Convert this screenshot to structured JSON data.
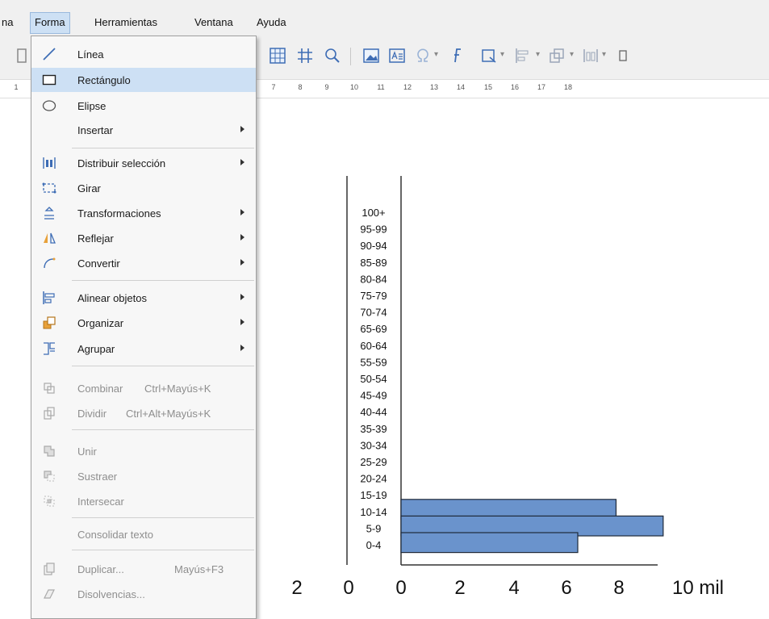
{
  "menubar": {
    "items": [
      {
        "label": "na"
      },
      {
        "label": "Forma",
        "open": true
      },
      {
        "label": "Herramientas"
      },
      {
        "label": "Ventana"
      },
      {
        "label": "Ayuda"
      }
    ]
  },
  "toolbar": {
    "icons": [
      "page-icon",
      "grid-icon",
      "hash-icon",
      "zoom-icon",
      "image-icon",
      "textbox-icon",
      "special-character-icon",
      "fontwork-icon",
      "transform-icon",
      "align-icon",
      "arrange-icon",
      "distribute-icon",
      "more-icon"
    ]
  },
  "ruler": {
    "numbers": [
      "1",
      "7",
      "8",
      "9",
      "10",
      "11",
      "12",
      "13",
      "14",
      "15",
      "16",
      "17",
      "18"
    ]
  },
  "menu": {
    "items": [
      {
        "label": "Línea",
        "icon": "line-icon",
        "enabled": true,
        "submenu": false
      },
      {
        "label": "Rectángulo",
        "icon": "rectangle-icon",
        "enabled": true,
        "submenu": false,
        "selected": true
      },
      {
        "label": "Elipse",
        "icon": "ellipse-icon",
        "enabled": true,
        "submenu": false
      },
      {
        "label": "Insertar",
        "icon": "",
        "enabled": true,
        "submenu": true
      },
      {
        "label": "Distribuir selección",
        "icon": "distribute-icon",
        "enabled": true,
        "submenu": true
      },
      {
        "label": "Girar",
        "icon": "rotate-icon",
        "enabled": true,
        "submenu": false
      },
      {
        "label": "Transformaciones",
        "icon": "transform-icon",
        "enabled": true,
        "submenu": true
      },
      {
        "label": "Reflejar",
        "icon": "flip-icon",
        "enabled": true,
        "submenu": true
      },
      {
        "label": "Convertir",
        "icon": "convert-icon",
        "enabled": true,
        "submenu": true
      },
      {
        "label": "Alinear objetos",
        "icon": "align-icon",
        "enabled": true,
        "submenu": true
      },
      {
        "label": "Organizar",
        "icon": "arrange-icon",
        "enabled": true,
        "submenu": true
      },
      {
        "label": "Agrupar",
        "icon": "group-icon",
        "enabled": true,
        "submenu": true
      },
      {
        "label": "Combinar",
        "shortcut": "Ctrl+Mayús+K",
        "icon": "combine-icon",
        "enabled": false,
        "submenu": false
      },
      {
        "label": "Dividir",
        "shortcut": "Ctrl+Alt+Mayús+K",
        "icon": "split-icon",
        "enabled": false,
        "submenu": false
      },
      {
        "label": "Unir",
        "icon": "merge-icon",
        "enabled": false,
        "submenu": false
      },
      {
        "label": "Sustraer",
        "icon": "subtract-icon",
        "enabled": false,
        "submenu": false
      },
      {
        "label": "Intersecar",
        "icon": "intersect-icon",
        "enabled": false,
        "submenu": false
      },
      {
        "label": "Consolidar texto",
        "icon": "",
        "enabled": false,
        "submenu": false
      },
      {
        "label": "Duplicar...",
        "shortcut": "Mayús+F3",
        "icon": "duplicate-icon",
        "enabled": false,
        "submenu": false
      },
      {
        "label": "Disolvencias...",
        "icon": "cross-fading-icon",
        "enabled": false,
        "submenu": false
      }
    ]
  },
  "chart_data": {
    "type": "bar",
    "orientation": "horizontal",
    "categories": [
      "100+",
      "95-99",
      "90-94",
      "85-89",
      "80-84",
      "75-79",
      "70-74",
      "65-69",
      "60-64",
      "55-59",
      "50-54",
      "45-49",
      "40-44",
      "35-39",
      "30-34",
      "25-29",
      "20-24",
      "15-19",
      "10-14",
      "5-9",
      "0-4"
    ],
    "series": [
      {
        "values": [
          0,
          0,
          0,
          0,
          0,
          0,
          0,
          0,
          0,
          0,
          0,
          0,
          0,
          0,
          0,
          0,
          0,
          0,
          7.3,
          8.9,
          6.0
        ]
      }
    ],
    "x_ticks": [
      "2",
      "0",
      "0",
      "2",
      "4",
      "6",
      "8",
      "10 mil"
    ],
    "xlim": [
      0,
      10
    ],
    "bar_color": "#6a93cc",
    "bar_stroke": "#1f2a3a"
  }
}
